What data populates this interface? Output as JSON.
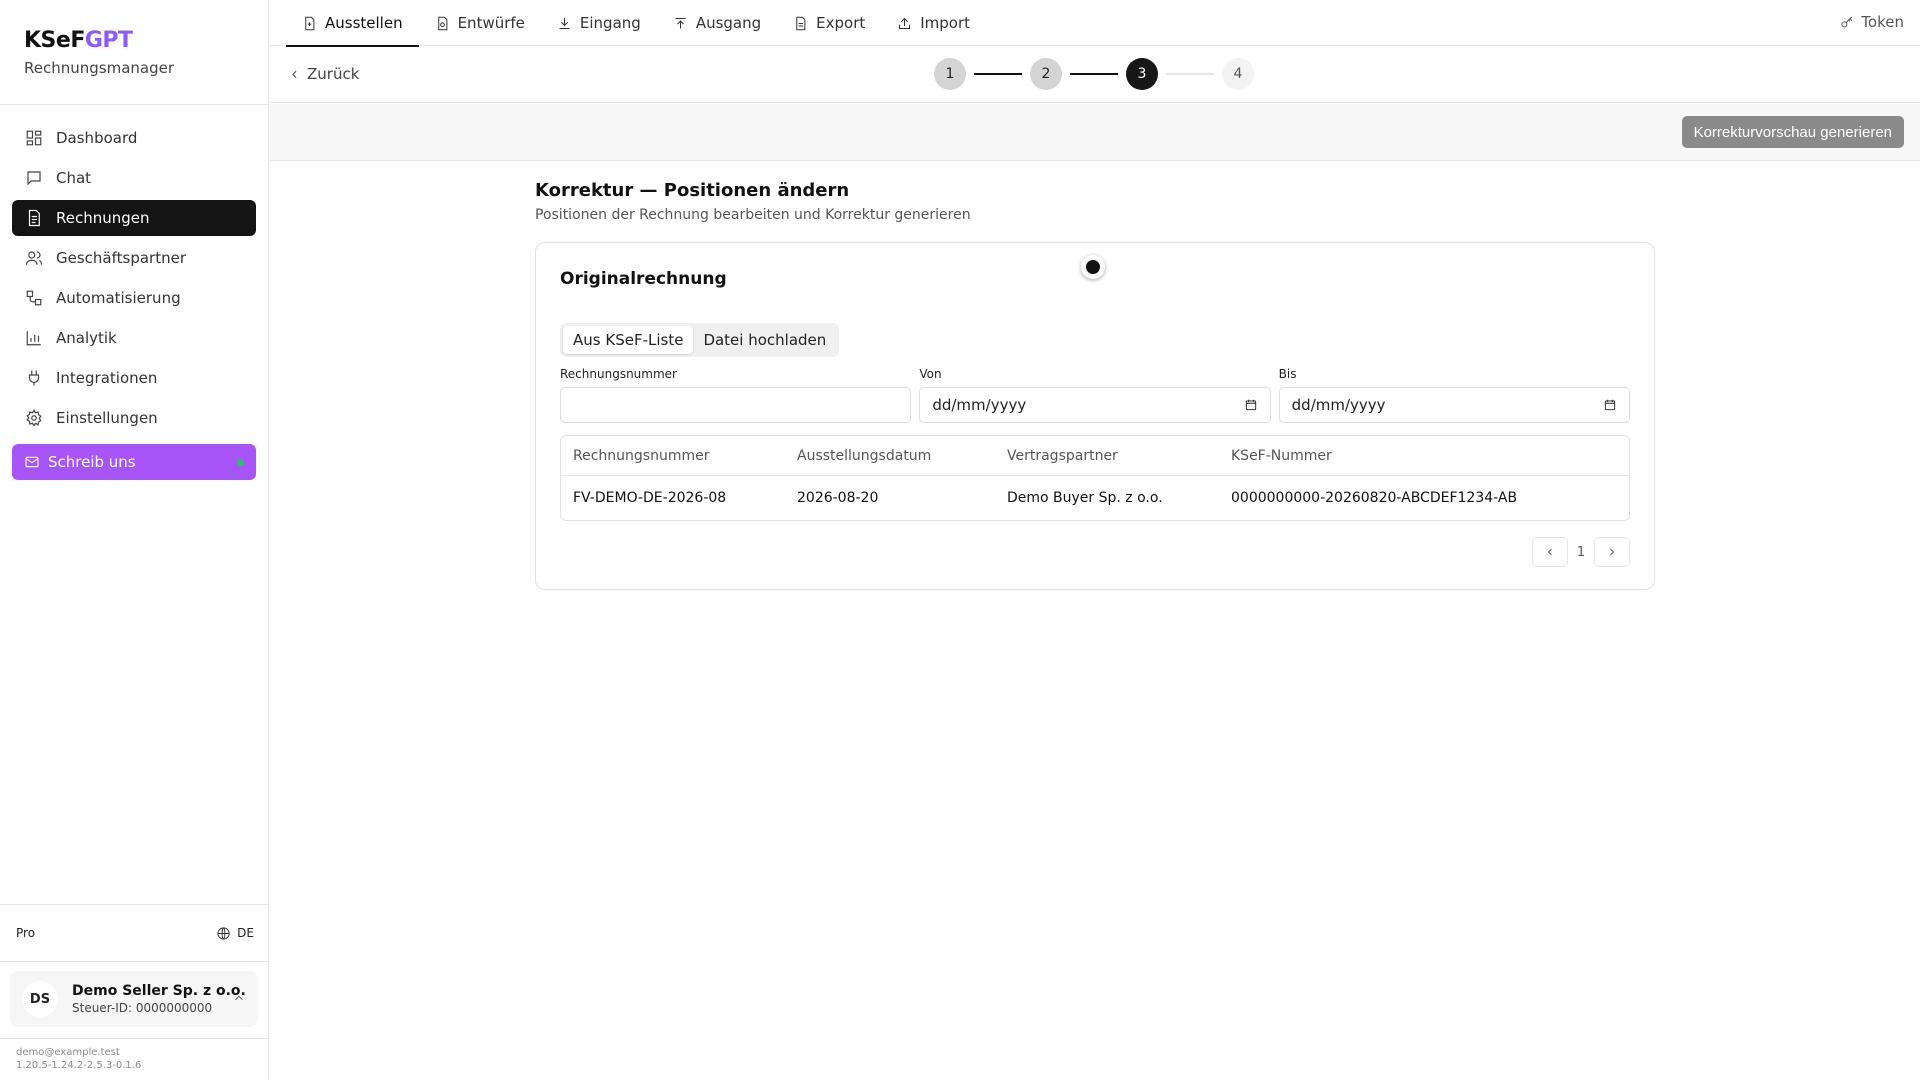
{
  "brand": {
    "name_part1": "KSeF",
    "name_part2": "GPT",
    "subtitle": "Rechnungsmanager",
    "accent_color": "#8b5cf6"
  },
  "sidebar": {
    "items": [
      {
        "label": "Dashboard",
        "icon": "dashboard-icon"
      },
      {
        "label": "Chat",
        "icon": "chat-icon"
      },
      {
        "label": "Rechnungen",
        "icon": "invoice-icon",
        "active": true
      },
      {
        "label": "Geschäftspartner",
        "icon": "users-icon"
      },
      {
        "label": "Automatisierung",
        "icon": "workflow-icon"
      },
      {
        "label": "Analytik",
        "icon": "bar-chart-icon"
      },
      {
        "label": "Integrationen",
        "icon": "plug-icon"
      },
      {
        "label": "Einstellungen",
        "icon": "gear-icon"
      }
    ],
    "contact": {
      "label": "Schreib uns",
      "icon": "mail-icon",
      "color": "#a855f7",
      "status_color": "#22c55e"
    },
    "plan": "Pro",
    "language": "DE",
    "account": {
      "initials": "DS",
      "name": "Demo Seller Sp. z o.o.",
      "tax_id": "Steuer-ID: 0000000000"
    },
    "email": "demo@example.test",
    "version": "1.20.5-1.24.2-2.5.3-0.1.6"
  },
  "topbar": {
    "tabs": [
      {
        "label": "Ausstellen",
        "icon": "file-plus-icon",
        "active": true
      },
      {
        "label": "Entwürfe",
        "icon": "draft-icon"
      },
      {
        "label": "Eingang",
        "icon": "download-icon"
      },
      {
        "label": "Ausgang",
        "icon": "upload-icon"
      },
      {
        "label": "Export",
        "icon": "file-export-icon"
      },
      {
        "label": "Import",
        "icon": "import-icon"
      }
    ],
    "token_label": "Token"
  },
  "subbar": {
    "back_label": "Zurück",
    "steps": [
      "1",
      "2",
      "3",
      "4"
    ],
    "current_step": 3
  },
  "actionbar": {
    "preview_button": "Korrekturvorschau generieren"
  },
  "page": {
    "title": "Korrektur — Positionen ändern",
    "subtitle": "Positionen der Rechnung bearbeiten und Korrektur generieren"
  },
  "card": {
    "title": "Originalrechnung",
    "source_tabs": [
      "Aus KSeF-Liste",
      "Datei hochladen"
    ],
    "active_source_tab": 0,
    "filters": {
      "invoice_number": {
        "label": "Rechnungsnummer",
        "value": ""
      },
      "from": {
        "label": "Von",
        "value": "dd/mm/yyyy"
      },
      "to": {
        "label": "Bis",
        "value": "dd/mm/yyyy"
      }
    },
    "table": {
      "columns": [
        "Rechnungsnummer",
        "Ausstellungsdatum",
        "Vertragspartner",
        "KSeF-Nummer"
      ],
      "rows": [
        [
          "FV-DEMO-DE-2026-08",
          "2026-08-20",
          "Demo Buyer Sp. z o.o.",
          "0000000000-20260820-ABCDEF1234-AB"
        ]
      ]
    },
    "pagination": {
      "page": "1"
    }
  }
}
